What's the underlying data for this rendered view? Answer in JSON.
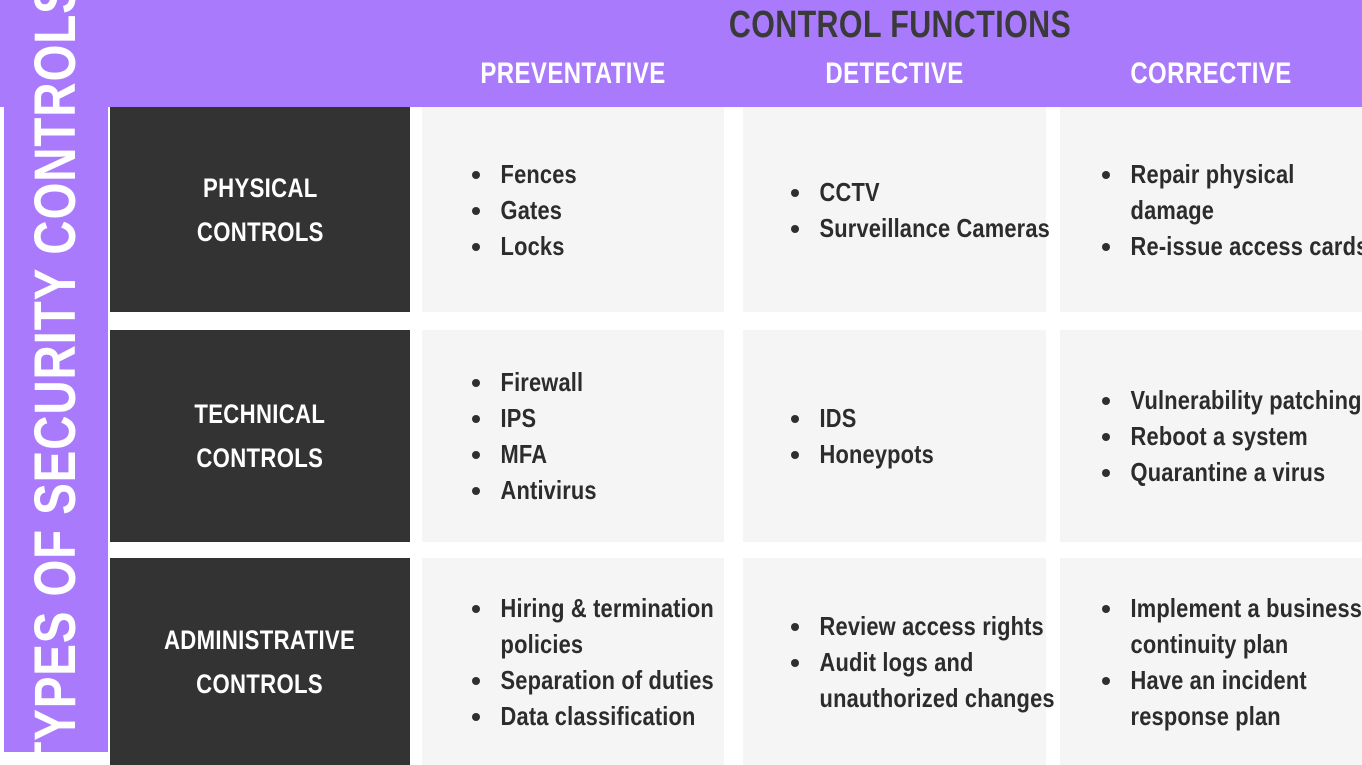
{
  "header": {
    "title": "CONTROL FUNCTIONS",
    "columns": [
      {
        "label": "PREVENTATIVE"
      },
      {
        "label": "DETECTIVE"
      },
      {
        "label": "CORRECTIVE"
      }
    ]
  },
  "side_rail": {
    "label": "TYPES OF SECURITY CONTROLS"
  },
  "colors": {
    "accent_purple": "#a97bfc",
    "label_cell_dark": "#333333",
    "content_cell_light": "#f5f5f5",
    "title_text": "#3a3a3a",
    "body_text": "#2c2c2c",
    "header_text": "#ffffff"
  },
  "matrix": {
    "rows": [
      {
        "label": "PHYSICAL\nCONTROLS",
        "preventative": [
          "Fences",
          "Gates",
          "Locks"
        ],
        "detective": [
          "CCTV",
          "Surveillance Cameras"
        ],
        "corrective": [
          "Repair physical damage",
          "Re-issue access cards"
        ]
      },
      {
        "label": "TECHNICAL\nCONTROLS",
        "preventative": [
          "Firewall",
          "IPS",
          "MFA",
          "Antivirus"
        ],
        "detective": [
          "IDS",
          "Honeypots"
        ],
        "corrective": [
          "Vulnerability patching",
          "Reboot a system",
          "Quarantine a virus"
        ]
      },
      {
        "label": "ADMINISTRATIVE\nCONTROLS",
        "preventative": [
          "Hiring & termination policies",
          "Separation of duties",
          "Data classification"
        ],
        "detective": [
          "Review access rights",
          "Audit logs and unauthorized changes"
        ],
        "corrective": [
          "Implement a business continuity plan",
          "Have an incident response plan"
        ]
      }
    ]
  }
}
